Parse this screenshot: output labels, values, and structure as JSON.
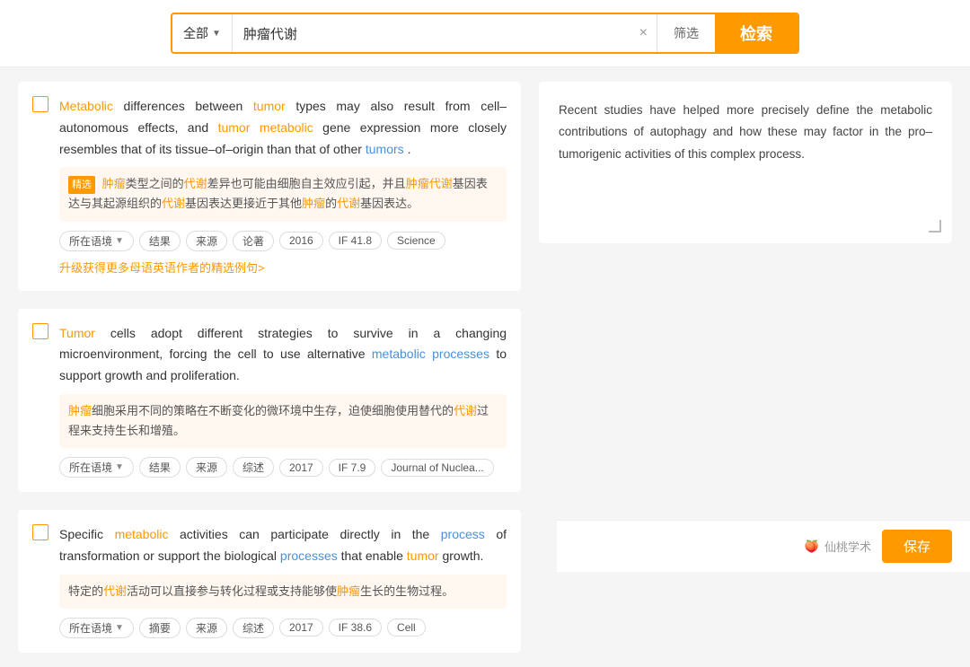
{
  "search": {
    "category_label": "全部",
    "query": "肿瘤代谢",
    "filter_label": "筛选",
    "search_label": "检索",
    "clear_icon": "×"
  },
  "results": [
    {
      "id": 1,
      "english": {
        "parts": [
          {
            "text": "Metabolic",
            "type": "orange"
          },
          {
            "text": " differences between ",
            "type": "normal"
          },
          {
            "text": "tumor",
            "type": "orange"
          },
          {
            "text": " types may also result from cell–autonomous effects, and ",
            "type": "normal"
          },
          {
            "text": "tumor",
            "type": "orange"
          },
          {
            "text": " ",
            "type": "normal"
          },
          {
            "text": "metabolic",
            "type": "orange"
          },
          {
            "text": " gene expression more closely resembles that of its tissue–of–origin than that of other ",
            "type": "normal"
          },
          {
            "text": "tumors",
            "type": "blue"
          },
          {
            "text": ".",
            "type": "normal"
          }
        ]
      },
      "translation_prefix": "精选",
      "translation": "肿瘤类型之间的代谢差异也可能由细胞自主效应引起，并且肿瘤代谢基因表达与其起源组织的代谢基因表达更接近于其他肿瘤的代谢基因表达。",
      "translation_highlights": [
        {
          "word": "肿瘤",
          "type": "orange"
        },
        {
          "word": "代谢",
          "type": "orange"
        },
        {
          "word": "肿瘤代谢",
          "type": "orange"
        },
        {
          "word": "代谢",
          "type": "orange"
        },
        {
          "word": "肿瘤",
          "type": "orange"
        },
        {
          "word": "代谢",
          "type": "orange"
        }
      ],
      "tags": [
        "所在语境",
        "结果",
        "来源",
        "论著",
        "2016",
        "IF 41.8",
        "Science"
      ],
      "upgrade_text": "升级获得更多母语英语作者的精选例句>",
      "has_tag_dropdown": [
        "所在语境"
      ]
    },
    {
      "id": 2,
      "english": {
        "parts": [
          {
            "text": "Tumor",
            "type": "orange"
          },
          {
            "text": " cells adopt different strategies to survive in a changing microenvironment, forcing the cell to use alternative ",
            "type": "normal"
          },
          {
            "text": "metabolic processes",
            "type": "blue"
          },
          {
            "text": " to support growth and proliferation.",
            "type": "normal"
          }
        ]
      },
      "translation": "肿瘤细胞采用不同的策略在不断变化的微环境中生存，迫使细胞使用替代的代谢过程来支持生长和增殖。",
      "tags": [
        "所在语境",
        "结果",
        "来源",
        "综述",
        "2017",
        "IF 7.9",
        "Journal of Nuclea..."
      ],
      "has_tag_dropdown": [
        "所在语境"
      ]
    },
    {
      "id": 3,
      "english": {
        "parts": [
          {
            "text": "Specific ",
            "type": "normal"
          },
          {
            "text": "metabolic",
            "type": "orange"
          },
          {
            "text": " activities can participate directly in the ",
            "type": "normal"
          },
          {
            "text": "process",
            "type": "blue"
          },
          {
            "text": " of transformation or support the biological ",
            "type": "normal"
          },
          {
            "text": "processes",
            "type": "blue"
          },
          {
            "text": " that enable ",
            "type": "normal"
          },
          {
            "text": "tumor",
            "type": "orange"
          },
          {
            "text": " growth.",
            "type": "normal"
          }
        ]
      },
      "translation": "特定的代谢活动可以直接参与转化过程或支持能够使肿瘤生长的生物过程。",
      "tags": [
        "所在语境",
        "摘要",
        "来源",
        "综述",
        "2017",
        "IF 38.6",
        "Cell"
      ],
      "has_tag_dropdown": [
        "所在语境"
      ]
    }
  ],
  "preview": {
    "text": "Recent studies have helped more precisely define the metabolic contributions of autophagy and how these may factor in the pro–tumorigenic activities of this complex process."
  },
  "footer": {
    "watermark": "仙桃学术",
    "save_label": "保存"
  }
}
